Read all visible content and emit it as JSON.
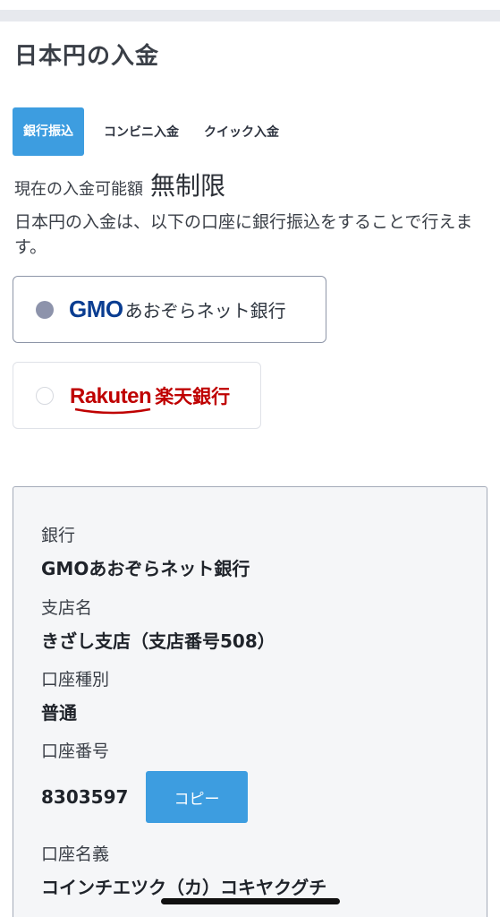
{
  "page": {
    "title": "日本円の入金"
  },
  "tabs": [
    {
      "label": "銀行振込",
      "active": true
    },
    {
      "label": "コンビニ入金",
      "active": false
    },
    {
      "label": "クイック入金",
      "active": false
    }
  ],
  "deposit_limit": {
    "label": "現在の入金可能額",
    "value": "無制限"
  },
  "description": "日本円の入金は、以下の口座に銀行振込をすることで行えます。",
  "bank_options": [
    {
      "logo_mark": "GMO",
      "name": "あおぞらネット銀行",
      "selected": true
    },
    {
      "logo_mark": "Rakuten",
      "name": "楽天銀行",
      "selected": false
    }
  ],
  "account": {
    "bank_label": "銀行",
    "bank_value": "GMOあおぞらネット銀行",
    "branch_label": "支店名",
    "branch_value": "きざし支店（支店番号508）",
    "type_label": "口座種別",
    "type_value": "普通",
    "number_label": "口座番号",
    "number_value": "8303597",
    "copy_label": "コピー",
    "holder_label": "口座名義",
    "holder_value": "コインチエツク（カ）コキヤクグチ"
  },
  "colors": {
    "accent": "#3d9de0",
    "gmo_blue": "#0a3d91",
    "rakuten_red": "#bf0000",
    "radio_selected": "#8d93ab"
  }
}
